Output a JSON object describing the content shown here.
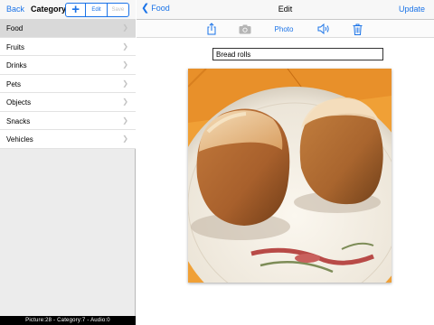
{
  "left": {
    "back_label": "Back",
    "title": "Category",
    "add_label": "+",
    "edit_label": "Edit",
    "save_label": "Save",
    "items": [
      {
        "label": "Food"
      },
      {
        "label": "Fruits"
      },
      {
        "label": "Drinks"
      },
      {
        "label": "Pets"
      },
      {
        "label": "Objects"
      },
      {
        "label": "Snacks"
      },
      {
        "label": "Vehicles"
      }
    ],
    "selected_index": 0,
    "status": "Picture:28 - Category:7 - Audio:0"
  },
  "right": {
    "back_label": "Food",
    "title": "Edit",
    "update_label": "Update",
    "toolbar": {
      "photo_label": "Photo",
      "icons": [
        "share-icon",
        "camera-icon",
        "speaker-icon",
        "trash-icon"
      ]
    },
    "name_value": "Bread rolls",
    "image_subject": "bread-rolls-photo"
  },
  "colors": {
    "accent": "#1a73e8",
    "selected_row": "#d9d9d9",
    "status_bar": "#000000"
  }
}
